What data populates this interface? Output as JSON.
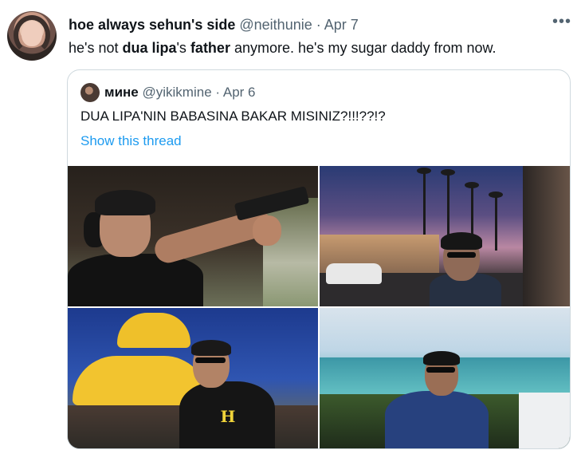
{
  "tweet": {
    "display_name": "hoe always sehun's side",
    "handle": "@neithunie",
    "separator": "·",
    "date": "Apr 7",
    "more_glyph": "•••",
    "text": {
      "part1": "he's not ",
      "bold1": "dua lipa",
      "part2": "'s ",
      "bold2": "father",
      "part3": " anymore. he's my sugar daddy from now."
    }
  },
  "quoted_tweet": {
    "display_name": "мине",
    "handle": "@yikikmine",
    "separator": "·",
    "date": "Apr 6",
    "text": "DUA LIPA'NIN BABASINA BAKAR MISINIZ?!!!??!?",
    "show_thread_label": "Show this thread",
    "photos": [
      {
        "description": "man aiming a pistol at a shooting range"
      },
      {
        "description": "man smoking on a palm-lined street at dusk"
      },
      {
        "description": "man in black hoodie near yellow umbrella at a festival"
      },
      {
        "description": "man in blue shirt by the sea with palm trees"
      }
    ],
    "hoodie_logo": "H"
  },
  "colors": {
    "text": "#0f1419",
    "secondary": "#536471",
    "link": "#1d9bf0",
    "border": "#cfd9de"
  }
}
